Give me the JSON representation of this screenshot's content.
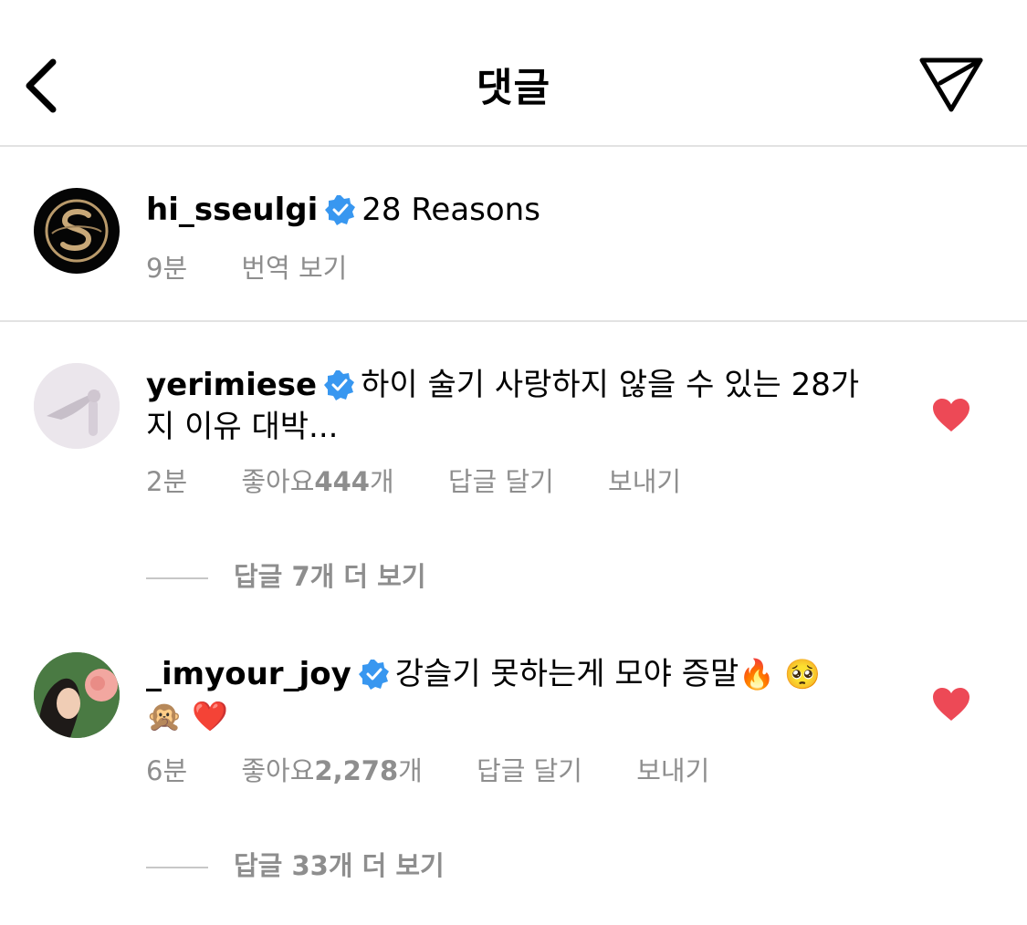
{
  "header": {
    "title": "댓글",
    "back_icon": "chevron-left-icon",
    "send_icon": "paper-plane-icon"
  },
  "caption": {
    "username": "hi_sseulgi",
    "verified": true,
    "text": "28 Reasons",
    "time": "9분",
    "translate": "번역 보기"
  },
  "comments": [
    {
      "username": "yerimiese",
      "verified": true,
      "text_line1": "하이 술기 사랑하지 않을 수 있는 28가",
      "text_line2": "지 이유 대박...",
      "time": "2분",
      "likes_prefix": "좋아요 ",
      "likes_count": "444",
      "likes_suffix": "개",
      "reply": "답글 달기",
      "send": "보내기",
      "liked": true,
      "view_replies": "답글 7개 더 보기"
    },
    {
      "username": "_imyour_joy",
      "verified": true,
      "text_line1": "강슬기 못하는게 모야 증말",
      "emoji_line1": "🔥 🥺",
      "emoji_line2": "🙊 ❤️",
      "time": "6분",
      "likes_prefix": "좋아요 ",
      "likes_count": "2,278",
      "likes_suffix": "개",
      "reply": "답글 달기",
      "send": "보내기",
      "liked": true,
      "view_replies": "답글 33개 더 보기"
    }
  ],
  "colors": {
    "verified_blue": "#3897f0",
    "like_red": "#ed4956",
    "meta_gray": "#8e8e8e",
    "divider": "#e2e2e2"
  }
}
